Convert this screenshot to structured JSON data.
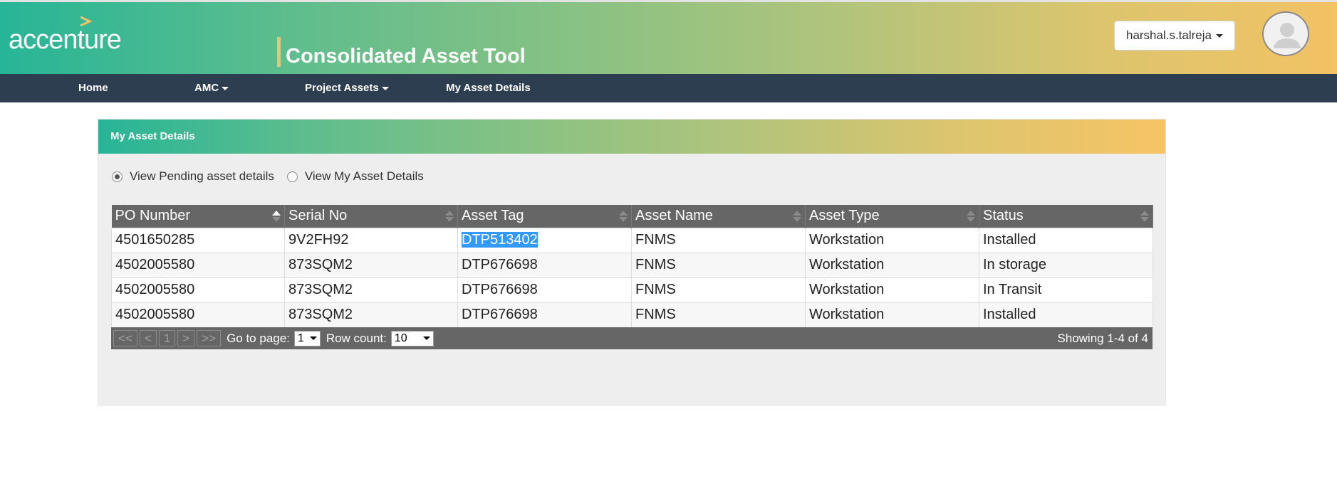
{
  "header": {
    "logo_text": "accenture",
    "app_title": "Consolidated Asset Tool",
    "user_menu_label": "harshal.s.talreja"
  },
  "nav": {
    "items": [
      {
        "label": "Home",
        "has_dropdown": false
      },
      {
        "label": "AMC",
        "has_dropdown": true
      },
      {
        "label": "Project Assets",
        "has_dropdown": true
      },
      {
        "label": "My Asset Details",
        "has_dropdown": false
      }
    ]
  },
  "panel": {
    "title": "My Asset Details",
    "radio_options": [
      {
        "label": "View Pending asset details",
        "checked": true
      },
      {
        "label": "View My Asset Details",
        "checked": false
      }
    ]
  },
  "table": {
    "columns": [
      "PO Number",
      "Serial No",
      "Asset Tag",
      "Asset Name",
      "Asset Type",
      "Status"
    ],
    "sorted_column": "PO Number",
    "rows": [
      [
        "4501650285",
        "9V2FH92",
        "DTP513402",
        "FNMS",
        "Workstation",
        "Installed"
      ],
      [
        "4502005580",
        "873SQM2",
        "DTP676698",
        "FNMS",
        "Workstation",
        "In storage"
      ],
      [
        "4502005580",
        "873SQM2",
        "DTP676698",
        "FNMS",
        "Workstation",
        "In Transit"
      ],
      [
        "4502005580",
        "873SQM2",
        "DTP676698",
        "FNMS",
        "Workstation",
        "Installed"
      ]
    ],
    "highlighted_cell_text": "DTP513402"
  },
  "pager": {
    "first": "<<",
    "prev": "<",
    "current_page": "1",
    "next": ">",
    "last": ">>",
    "goto_label": "Go to page:",
    "goto_value": "1",
    "rowcount_label": "Row count:",
    "rowcount_value": "10",
    "status_text": "Showing 1-4 of 4"
  },
  "colors": {
    "nav_bg": "#2c3e50",
    "gradient_start": "#27b597",
    "gradient_end": "#f2c264",
    "table_header_bg": "#666666",
    "selection": "#3399ff"
  }
}
